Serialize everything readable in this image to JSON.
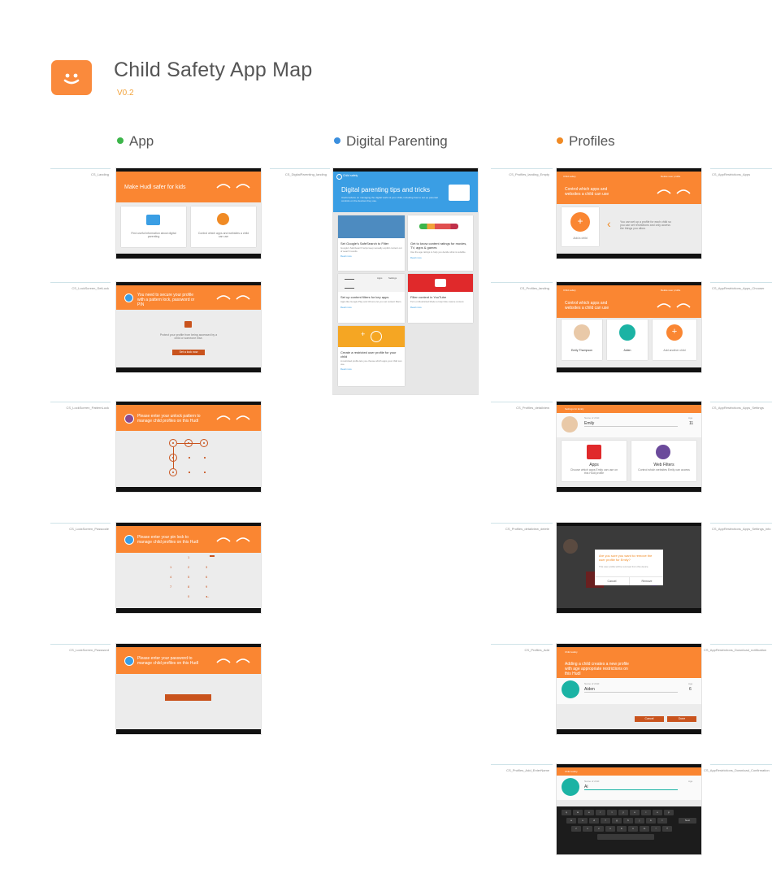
{
  "header": {
    "title": "Child Safety App Map",
    "version": "V0.2"
  },
  "colors": {
    "accent": "#fa8632",
    "app_dot": "#3cb54a",
    "digital_dot": "#3b8fde",
    "profiles_dot": "#f08a24",
    "blue_header": "#3a9ee4"
  },
  "columns": {
    "app": "App",
    "digital": "Digital Parenting",
    "profiles": "Profiles"
  },
  "labels": {
    "app": [
      "CS_Landing",
      "CS_LockScreen_SetLock",
      "CS_LockScreen_PatternLock",
      "CS_LockScreen_Passcode",
      "CS_LockScreen_Password"
    ],
    "digital": [
      "CS_DigitalParenting_landing"
    ],
    "profiles": [
      "CS_Profiles_landing_Empty",
      "CS_Profiles_landing",
      "CS_Profiles_detailview",
      "CS_Profiles_detailview_delete",
      "CS_Profiles_Add",
      "CS_Profiles_Add_EnterName"
    ],
    "apps": [
      "CS_AppRestrictions_Apps",
      "CS_AppRestrictions_Apps_Chooser",
      "CS_AppRestrictions_Apps_Settings",
      "CS_AppRestrictions_Apps_Settings_info",
      "CS_AppRestrictions_Download_notification",
      "CS_AppRestrictions_Download_Confirmation"
    ]
  },
  "screens": {
    "landing": {
      "title": "Make Hudl safer for kids",
      "card1": "Find useful information about digital parenting",
      "card2": "Control which apps and websites a child can use"
    },
    "setlock": {
      "text": "You need to secure your profile with a pattern lock, password or PIN",
      "body": "Protect your profile from being accessed by a child or someone else.",
      "button": "Set a lock now"
    },
    "pattern": {
      "text": "Please enter your unlock pattern to manage child profiles on this Hudl"
    },
    "passcode": {
      "text": "Please enter your pin lock to manage child profiles on this Hudl",
      "keys": [
        "1",
        "2",
        "3",
        "4",
        "5",
        "6",
        "7",
        "8",
        "9",
        "0"
      ]
    },
    "password": {
      "text": "Please enter your password to manage child profiles on this Hudl"
    },
    "digital": {
      "app_name": "Child safety",
      "heading": "Digital parenting tips and tricks",
      "intro": "Useful advice on managing the digital world of your child, including how to set up parental controls on the devices they use.",
      "tiles": [
        {
          "title": "Set Google's SafeSearch to Filter",
          "body": "Google's SafeSearch helps keep sexually explicit content out of search results.",
          "more": "Read more"
        },
        {
          "title": "Get to know content ratings for movies, TV, apps & games",
          "body": "Use the age ratings to help you decide what is suitable.",
          "more": "Read more"
        },
        {
          "title": "Set up content filters for key apps",
          "body": "Apps like Google Play and Chrome let you set content filters.",
          "more": "Read more"
        },
        {
          "title": "Filter content in YouTube",
          "body": "Turn on Restricted Mode to help hide mature content.",
          "more": "Read more"
        },
        {
          "title": "Create a restricted user profile for your child",
          "body": "A restricted profile lets you choose which apps your child can use.",
          "more": "Read more"
        }
      ],
      "tab_apps": "Apps",
      "tab_settings": "Settings"
    },
    "profiles_empty": {
      "app_name": "Child safety",
      "action": "Delete user profile",
      "band": "Control which apps and websites a child can use",
      "add": "Add a child",
      "hint": "You can set up a profile for each child so you can set restrictions and only access the things you allow."
    },
    "profiles_landing": {
      "app_name": "Child safety",
      "action": "Delete user profile",
      "band": "Control which apps and websites a child can use",
      "children": [
        "Emily Thompson",
        "Aiden"
      ],
      "add": "Add another child"
    },
    "detail": {
      "app_name": "Settings for Emily",
      "name_label": "Name of child",
      "name": "Emily",
      "age_label": "Age",
      "age": "11",
      "apps": "Apps",
      "apps_desc": "Choose which apps Emily can use on this Hudl profile",
      "web": "Web Filters",
      "web_desc": "Control which websites Emily can access"
    },
    "delete": {
      "question": "Are you sure you want to remove the user profile for Emily?",
      "body": "This user profile will be removed from this device.",
      "cancel": "Cancel",
      "remove": "Remove"
    },
    "add": {
      "app_name": "Child safety",
      "band": "Adding a child creates a new profile with age appropriate restrictions on this Hudl",
      "name_label": "Name of child",
      "name": "Aiden",
      "age_label": "Age",
      "age": "6",
      "cancel": "Cancel",
      "done": "Done"
    },
    "enter_name": {
      "app_name": "Child safety",
      "name_label": "Name of child",
      "name": "Ai",
      "age_label": "Age",
      "keyboard_rows": [
        [
          "q",
          "w",
          "e",
          "r",
          "t",
          "y",
          "u",
          "i",
          "o",
          "p"
        ],
        [
          "a",
          "s",
          "d",
          "f",
          "g",
          "h",
          "j",
          "k",
          "l"
        ],
        [
          "z",
          "x",
          "c",
          "v",
          "b",
          "n",
          "m",
          "!",
          "?"
        ]
      ],
      "next_key": "Next"
    }
  }
}
